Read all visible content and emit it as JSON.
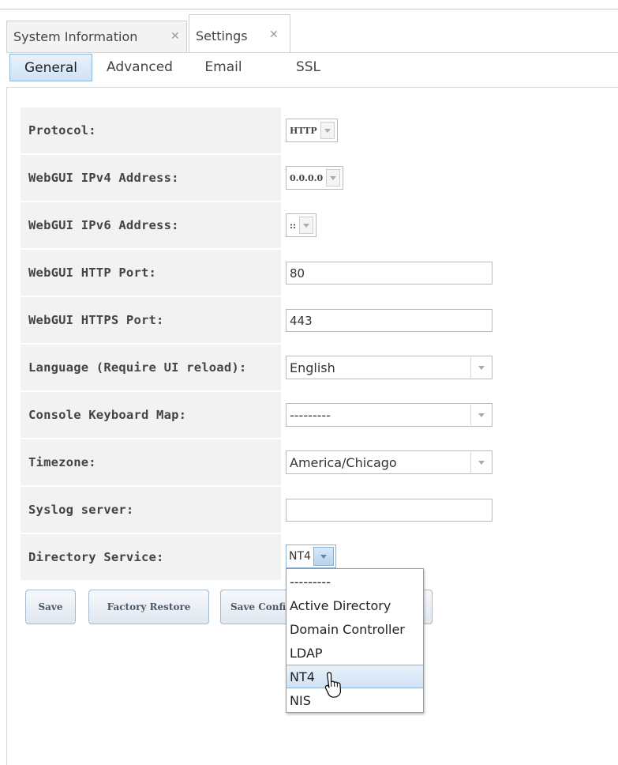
{
  "tabs": [
    {
      "label": "System Information",
      "close": "✕"
    },
    {
      "label": "Settings",
      "close": "✕"
    }
  ],
  "subtabs": [
    "General",
    "Advanced",
    "Email",
    "SSL"
  ],
  "form": {
    "protocol": {
      "label": "Protocol:",
      "value": "HTTP"
    },
    "ipv4": {
      "label": "WebGUI IPv4 Address:",
      "value": "0.0.0.0"
    },
    "ipv6": {
      "label": "WebGUI IPv6 Address:",
      "value": "::"
    },
    "http_port": {
      "label": "WebGUI HTTP Port:",
      "value": "80"
    },
    "https_port": {
      "label": "WebGUI HTTPS Port:",
      "value": "443"
    },
    "language": {
      "label": "Language (Require UI reload):",
      "value": "English"
    },
    "keymap": {
      "label": "Console Keyboard Map:",
      "value": "---------"
    },
    "timezone": {
      "label": "Timezone:",
      "value": "America/Chicago"
    },
    "syslog": {
      "label": "Syslog server:",
      "value": ""
    },
    "directory": {
      "label": "Directory Service:",
      "value": "NT4"
    }
  },
  "buttons": {
    "save": "Save",
    "factory_restore": "Factory Restore",
    "save_config": "Save Config"
  },
  "directory_options": [
    "---------",
    "Active Directory",
    "Domain Controller",
    "LDAP",
    "NT4",
    "NIS"
  ],
  "directory_highlighted": "NT4",
  "icons": {
    "tab_close": "close-icon",
    "cursor": "hand-pointer-icon",
    "dropdown_arrow": "chevron-down-icon"
  }
}
